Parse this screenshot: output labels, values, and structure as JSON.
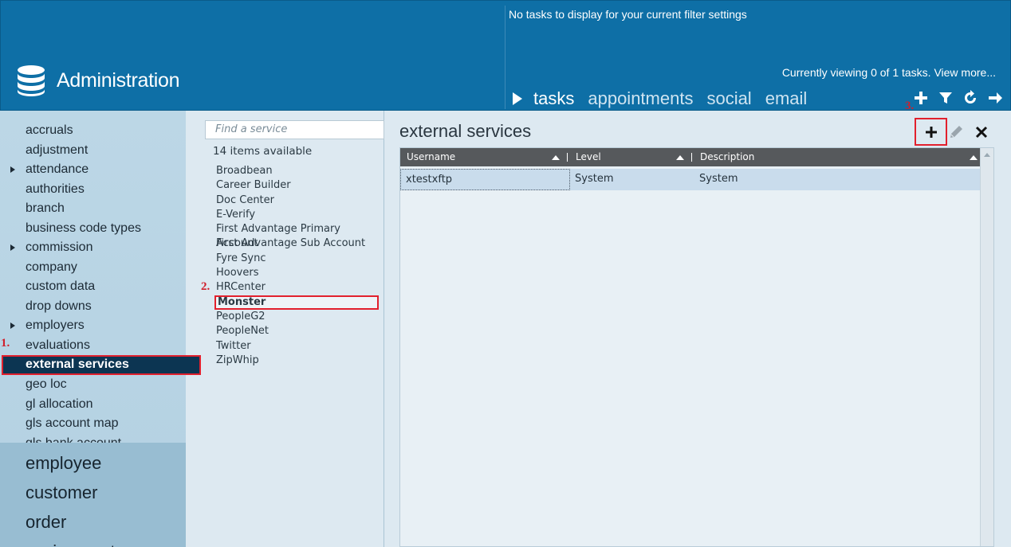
{
  "header": {
    "app_title": "Administration",
    "notice": "No tasks to display for your current filter settings",
    "viewing": "Currently viewing 0 of 1 tasks. View more...",
    "tabs": [
      {
        "label": "tasks",
        "active": true
      },
      {
        "label": "appointments",
        "active": false
      },
      {
        "label": "social",
        "active": false
      },
      {
        "label": "email",
        "active": false
      }
    ],
    "icons": [
      "plus-icon",
      "filter-icon",
      "refresh-icon",
      "arrow-right-icon"
    ]
  },
  "sidebar": {
    "items": [
      {
        "label": "accruals",
        "expandable": false
      },
      {
        "label": "adjustment",
        "expandable": false
      },
      {
        "label": "attendance",
        "expandable": true
      },
      {
        "label": "authorities",
        "expandable": false
      },
      {
        "label": "branch",
        "expandable": false
      },
      {
        "label": "business code types",
        "expandable": false
      },
      {
        "label": "commission",
        "expandable": true
      },
      {
        "label": "company",
        "expandable": false
      },
      {
        "label": "custom data",
        "expandable": false
      },
      {
        "label": "drop downs",
        "expandable": false
      },
      {
        "label": "employers",
        "expandable": true
      },
      {
        "label": "evaluations",
        "expandable": false
      },
      {
        "label": "external services",
        "expandable": false,
        "selected": true
      },
      {
        "label": "geo loc",
        "expandable": false
      },
      {
        "label": "gl allocation",
        "expandable": false
      },
      {
        "label": "gls account map",
        "expandable": false
      },
      {
        "label": "gls bank account",
        "expandable": false
      }
    ],
    "big_items": [
      "employee",
      "customer",
      "order",
      "assignment"
    ]
  },
  "services": {
    "search_placeholder": "Find a service",
    "count_label": "14 items available",
    "items": [
      "Broadbean",
      "Career Builder",
      "Doc Center",
      "E-Verify",
      "First Advantage Primary Account",
      "First Advantage Sub Account",
      "Fyre Sync",
      "Hoovers",
      "HRCenter",
      "Monster",
      "PeopleG2",
      "PeopleNet",
      "Twitter",
      "ZipWhip"
    ],
    "selected": "Monster"
  },
  "content": {
    "title": "external services",
    "columns": [
      "Username",
      "Level",
      "Description"
    ],
    "rows": [
      {
        "username": "xtestxftp",
        "level": "System",
        "description": "System"
      }
    ]
  },
  "steps": [
    "1.",
    "2.",
    "3."
  ],
  "colors": {
    "header_bg": "#0e6fa6",
    "highlight": "#e2202d",
    "selected_nav": "#0c3552"
  }
}
